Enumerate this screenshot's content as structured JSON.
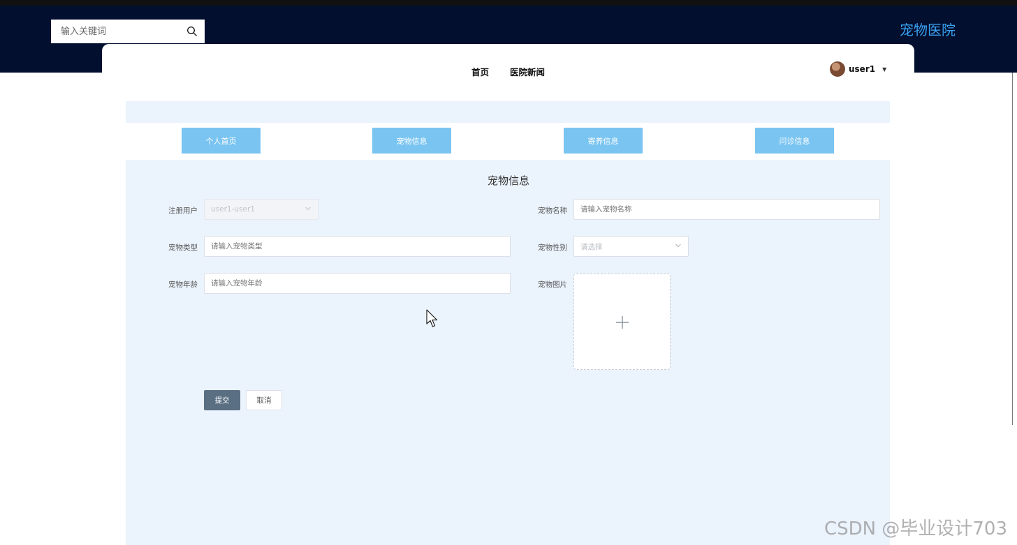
{
  "header": {
    "search_placeholder": "输入关键词",
    "brand": "宠物医院",
    "brand_color": "#3aa0ef",
    "background_color": "#020f2f"
  },
  "nav": {
    "items": [
      {
        "label": "首页"
      },
      {
        "label": "医院新闻"
      }
    ],
    "user": {
      "name": "user1"
    }
  },
  "tabs": [
    {
      "label": "个人首页"
    },
    {
      "label": "宠物信息"
    },
    {
      "label": "寄养信息"
    },
    {
      "label": "问诊信息"
    }
  ],
  "form": {
    "title": "宠物信息",
    "fields": {
      "register_user": {
        "label": "注册用户",
        "value": "user1-user1",
        "disabled": true
      },
      "pet_name": {
        "label": "宠物名称",
        "placeholder": "请输入宠物名称"
      },
      "pet_type": {
        "label": "宠物类型",
        "placeholder": "请输入宠物类型"
      },
      "pet_gender": {
        "label": "宠物性别",
        "placeholder": "请选择"
      },
      "pet_age": {
        "label": "宠物年龄",
        "placeholder": "请输入宠物年龄"
      },
      "pet_image": {
        "label": "宠物图片"
      }
    },
    "submit_label": "提交",
    "cancel_label": "取消"
  },
  "watermark": "CSDN @毕业设计703",
  "icons": {
    "search": "search-icon",
    "chevron": "chevron-down-icon",
    "plus": "plus-icon",
    "cursor": "mouse-cursor-icon",
    "caret": "caret-down-icon"
  },
  "colors": {
    "tab_bg": "#7ac4f1",
    "page_bg": "#ebf3fd",
    "submit_bg": "#5b6f83"
  }
}
